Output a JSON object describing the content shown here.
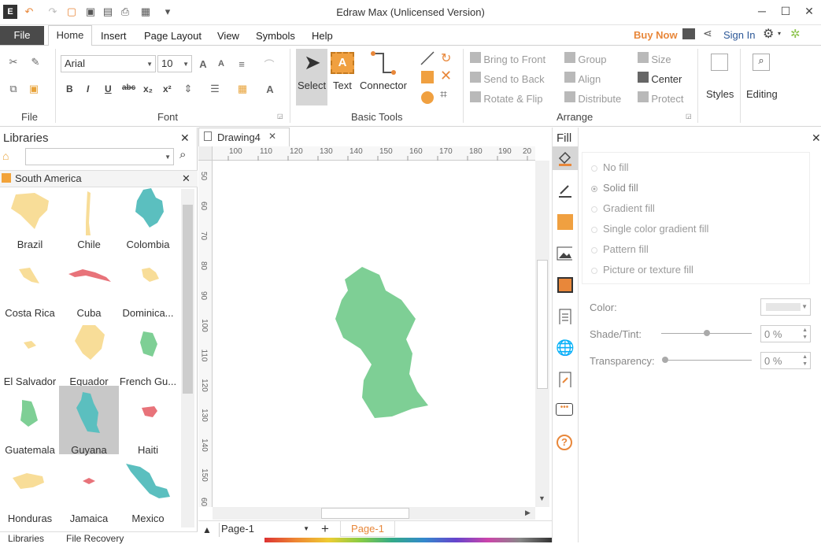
{
  "window": {
    "title": "Edraw Max (Unlicensed Version)",
    "buy_now": "Buy Now",
    "sign_in": "Sign In"
  },
  "menu": {
    "file": "File",
    "tabs": [
      "Home",
      "Insert",
      "Page Layout",
      "View",
      "Symbols",
      "Help"
    ]
  },
  "ribbon": {
    "file_group": "File",
    "font_group": "Font",
    "font_name": "Arial",
    "font_size": "10",
    "basic_tools_group": "Basic Tools",
    "select": "Select",
    "text": "Text",
    "connector": "Connector",
    "arrange_group": "Arrange",
    "arrange": {
      "bring_front": "Bring to Front",
      "send_back": "Send to Back",
      "rotate_flip": "Rotate & Flip",
      "group": "Group",
      "align": "Align",
      "distribute": "Distribute",
      "size": "Size",
      "center": "Center",
      "protect": "Protect"
    },
    "styles": "Styles",
    "editing": "Editing"
  },
  "libraries": {
    "title": "Libraries",
    "category": "South America",
    "items": [
      "Brazil",
      "Chile",
      "Colombia",
      "Costa Rica",
      "Cuba",
      "Dominica...",
      "El Salvador",
      "Equador",
      "French Gu...",
      "Guatemala",
      "Guyana",
      "Haiti",
      "Honduras",
      "Jamaica",
      "Mexico"
    ],
    "bottom_tabs": [
      "Libraries",
      "File Recovery"
    ]
  },
  "document": {
    "tab": "Drawing4",
    "page_select": "Page-1",
    "page_tab": "Page-1",
    "ruler_h": [
      "100",
      "110",
      "120",
      "130",
      "140",
      "150",
      "160",
      "170",
      "180",
      "190",
      "20"
    ],
    "ruler_v": [
      "50",
      "60",
      "70",
      "80",
      "90",
      "100",
      "110",
      "120",
      "130",
      "140",
      "150",
      "60"
    ]
  },
  "fill_panel": {
    "title": "Fill",
    "options": [
      "No fill",
      "Solid fill",
      "Gradient fill",
      "Single color gradient fill",
      "Pattern fill",
      "Picture or texture fill"
    ],
    "color_label": "Color:",
    "shade_label": "Shade/Tint:",
    "shade_value": "0 %",
    "transparency_label": "Transparency:",
    "transparency_value": "0 %"
  },
  "colors": {
    "accent": "#e8873a",
    "guyana_fill": "#7ecf95",
    "teal": "#5bbfbf",
    "sand": "#f8dd98",
    "red": "#e8737a"
  }
}
